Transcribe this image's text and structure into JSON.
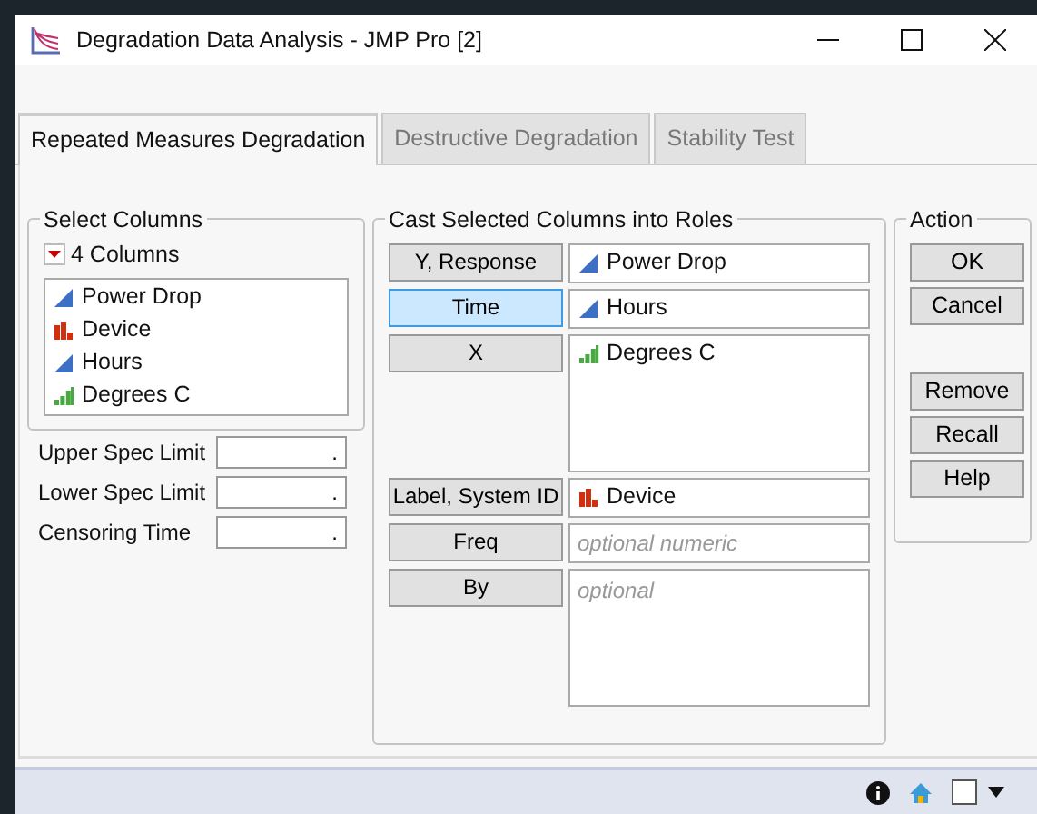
{
  "window": {
    "title": "Degradation Data Analysis - JMP Pro [2]"
  },
  "tabs": [
    {
      "label": "Repeated Measures Degradation",
      "selected": true
    },
    {
      "label": "Destructive Degradation",
      "selected": false
    },
    {
      "label": "Stability Test",
      "selected": false
    }
  ],
  "select_columns": {
    "title": "Select Columns",
    "count": "4 Columns",
    "columns": [
      {
        "name": "Power Drop",
        "kind": "continuous"
      },
      {
        "name": "Device",
        "kind": "nominal"
      },
      {
        "name": "Hours",
        "kind": "continuous"
      },
      {
        "name": "Degrees C",
        "kind": "ordinal"
      }
    ]
  },
  "spec_fields": [
    {
      "label": "Upper Spec Limit",
      "value": "."
    },
    {
      "label": "Lower Spec Limit",
      "value": "."
    },
    {
      "label": "Censoring Time",
      "value": "."
    }
  ],
  "cast": {
    "title": "Cast Selected Columns into Roles",
    "roles": [
      {
        "button": "Y, Response",
        "selected": false,
        "kind": "single",
        "items": [
          {
            "name": "Power Drop",
            "kind": "continuous"
          }
        ]
      },
      {
        "button": "Time",
        "selected": true,
        "kind": "single",
        "items": [
          {
            "name": "Hours",
            "kind": "continuous"
          }
        ]
      },
      {
        "button": "X",
        "selected": false,
        "kind": "tall",
        "items": [
          {
            "name": "Degrees C",
            "kind": "ordinal"
          }
        ]
      },
      {
        "button": "Label, System ID",
        "selected": false,
        "kind": "single",
        "items": [
          {
            "name": "Device",
            "kind": "nominal"
          }
        ]
      },
      {
        "button": "Freq",
        "selected": false,
        "kind": "single",
        "placeholder": "optional numeric"
      },
      {
        "button": "By",
        "selected": false,
        "kind": "tall",
        "placeholder": "optional"
      }
    ]
  },
  "action": {
    "title": "Action",
    "main_buttons": [
      "OK",
      "Cancel"
    ],
    "tool_buttons": [
      "Remove",
      "Recall",
      "Help"
    ]
  }
}
